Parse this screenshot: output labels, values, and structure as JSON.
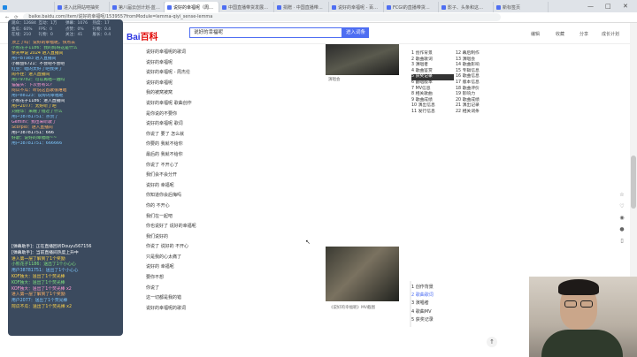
{
  "tabs": [
    {
      "label": "",
      "icon": "bilibili-favicon"
    },
    {
      "label": "进入此网站吧抽奖",
      "icon": "page-favicon"
    },
    {
      "label": "第八届云创计划-蓝凌…",
      "icon": "page-favicon"
    },
    {
      "label": "说好的幸福呢（周…",
      "icon": "baidu-favicon",
      "active": true
    },
    {
      "label": "中国直播带货发展现…",
      "icon": "page-favicon"
    },
    {
      "label": "捐赠 · 中国直播带货…",
      "icon": "page-favicon"
    },
    {
      "label": "说好的幸福呢 - 百度…",
      "icon": "page-favicon"
    },
    {
      "label": "FCGI的直播带货…",
      "icon": "page-favicon"
    },
    {
      "label": "影子、头条和这…",
      "icon": "page-favicon"
    },
    {
      "label": "新标签页",
      "icon": "page-favicon"
    }
  ],
  "url": "baike.baidu.com/item/说好的幸福呢/1539557fromModule=lemma-qiyi_sense-lemma",
  "baidu": {
    "logo_text": "Bai",
    "logo_red": "百科",
    "search_value": "说好的幸福呢",
    "search_button": "进入词条",
    "links": [
      "编辑",
      "收藏",
      "分享"
    ],
    "user": "成长计划"
  },
  "chat_stats": [
    [
      "观众",
      "12684"
    ],
    [
      "互动",
      "1万"
    ],
    [
      "弹幕",
      "1076"
    ],
    [
      "热度",
      "17"
    ],
    [
      "金瓜",
      "60%"
    ],
    [
      "FPS",
      "0"
    ],
    [
      "点赞",
      "0%"
    ],
    [
      "礼物",
      "0.4"
    ],
    [
      "在线",
      "210"
    ],
    [
      "礼物",
      "0"
    ],
    [
      "关注",
      "41"
    ],
    [
      "舰长",
      "0.4"
    ]
  ],
  "chat_messages": [
    {
      "c": "c-o",
      "t": "顶上了吗：说好的幸福呢，快点去"
    },
    {
      "c": "c-g",
      "t": "小熊花子1186：我的妈呀这是什么"
    },
    {
      "c": "c-y",
      "t": "余光中说 2024 进入直播间"
    },
    {
      "c": "c-b",
      "t": "用户BT983 进入直播间"
    },
    {
      "c": "c-w",
      "t": "小鲸鱼6721：不会吧不会吧"
    },
    {
      "c": "c-b",
      "t": "红豆：唱的太好了吧我哭了"
    },
    {
      "c": "c-y",
      "t": "闹不住：进入直播间"
    },
    {
      "c": "c-g",
      "t": "用户9782：可以再唱一遍吗"
    },
    {
      "c": "c-p",
      "t": "猫猫头：下次会有么？"
    },
    {
      "c": "c-o",
      "t": "阿瓜不瓜：听说这首歌很难唱"
    },
    {
      "c": "c-b",
      "t": "用户88123：说好的幸福呢"
    },
    {
      "c": "c-w",
      "t": "小熊花子1186：进入直播间"
    },
    {
      "c": "c-y",
      "t": "用户2077：太好听了吧"
    },
    {
      "c": "c-g",
      "t": "刘德华：来晚了错过了什么"
    },
    {
      "c": "c-b",
      "t": "用户38781751：点赞了"
    },
    {
      "c": "c-p",
      "t": "Gemini：我也来听歌了"
    },
    {
      "c": "c-o",
      "t": "Scorpio：进入直播间"
    },
    {
      "c": "c-w",
      "t": "用户38781751：666"
    },
    {
      "c": "c-g",
      "t": "好歌：说好的幸福呢~~"
    },
    {
      "c": "c-b",
      "t": "用户38781751：666666"
    }
  ],
  "chat2_messages": [
    {
      "c": "c-w",
      "t": "[弹幕助手]：正在直播回听Douyu567156"
    },
    {
      "c": "c-w",
      "t": "[弹幕助手]：当前直播间热度上升中"
    },
    {
      "c": "c-y",
      "t": "进入第一层了解到了1个奖励"
    },
    {
      "c": "c-g",
      "t": "小熊花子1186：送出了1个小心心"
    },
    {
      "c": "c-b",
      "t": "用户38781751：送出了1个小心心"
    },
    {
      "c": "c-y",
      "t": "KOF独大：送出了1个荧光棒"
    },
    {
      "c": "c-g",
      "t": "KOF独大：送出了1个荧光棒"
    },
    {
      "c": "c-p",
      "t": "KOF独大：送出了1个荧光棒 x2"
    },
    {
      "c": "c-o",
      "t": "进入第一层了解到了1个奖励"
    },
    {
      "c": "c-b",
      "t": "用户2077：送出了1个荧光棒"
    },
    {
      "c": "c-y",
      "t": "阿瓜不瓜：送出了1个荧光棒 x2"
    }
  ],
  "main_list": [
    "说好的幸福呢的歌词",
    "说好的幸福呢",
    "说好的幸福呢 - 周杰伦",
    "说好的幸福呢",
    "我的被窝被窝",
    "说好的幸福呢 歌曲创作",
    "是你说的不要你",
    "说好的幸福呢 歌词",
    "你说了 要了 怎么就",
    "你要的 我就不给你",
    "最后的 我就不给你",
    "你说了 不开心了",
    "我们会不会分开",
    "说好的 幸福呢",
    "你知道你会后悔吗",
    "你的 不开心",
    "我们在一起吧",
    "你也说好了 说好的幸福呢",
    "我们说好的",
    "你说了 说好的 不开心",
    "只是我的心太痛了",
    "说好的 幸福呢",
    "要你不想",
    "你说了",
    "这一切都是我的错",
    "说好的幸福呢的歌词"
  ],
  "img1_caption": "演唱会",
  "img2_caption": "《说好的幸福呢》MV截图",
  "toc_col1": [
    "1 创作背景",
    "2 歌曲歌词",
    "3 演唱者",
    "4 歌曲鉴赏",
    "5 获奖记录",
    "6 翻唱版本",
    "7 MV信息",
    "8 相关歌曲",
    "9 歌曲成绩",
    "10 演出信息",
    "11 发行信息"
  ],
  "toc_col2": [
    "12 幕后制作",
    "13 演唱会",
    "14 歌曲影响",
    "15 专辑信息",
    "16 歌曲信息",
    "17 版本信息",
    "18 歌曲评价",
    "19 影响力",
    "20 歌曲成绩",
    "21 演出记录",
    "22 相关词条"
  ],
  "toc_selected_index": 4,
  "toc2": [
    "1 创作背景",
    "2 歌曲歌词",
    "3 演唱者",
    "4 歌曲MV",
    "5 获奖记录"
  ],
  "toc2_current": 1
}
